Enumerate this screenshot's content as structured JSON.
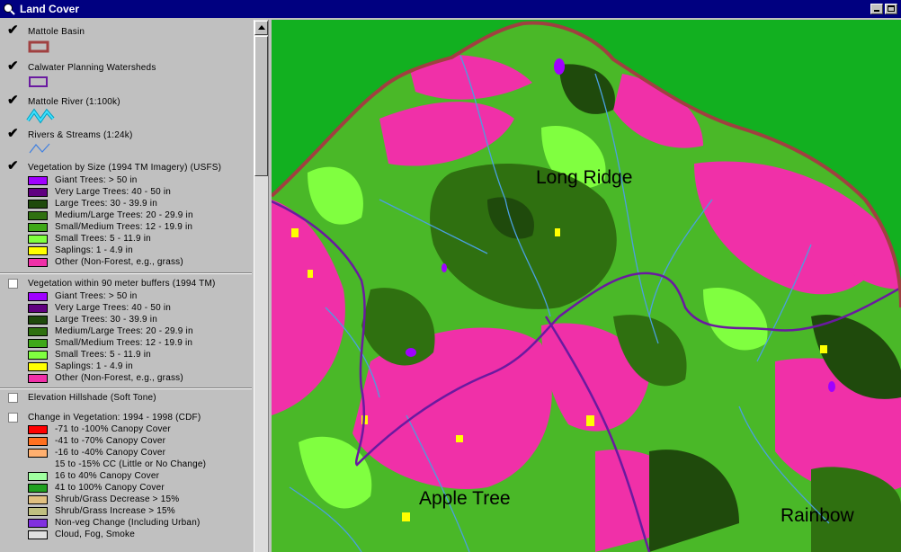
{
  "window": {
    "title": "Land Cover"
  },
  "legend": {
    "layers": [
      {
        "name": "Mattole Basin",
        "checked": true
      },
      {
        "name": "Calwater Planning Watersheds",
        "checked": true
      },
      {
        "name": "Mattole River (1:100k)",
        "checked": true
      },
      {
        "name": "Rivers & Streams (1:24k)",
        "checked": true
      },
      {
        "name": "Vegetation by Size (1994 TM Imagery) (USFS)",
        "checked": true,
        "classes": [
          {
            "label": "Giant Trees: > 50 in",
            "color": "#a000ff"
          },
          {
            "label": "Very Large Trees: 40 - 50 in",
            "color": "#600080"
          },
          {
            "label": "Large Trees: 30 - 39.9 in",
            "color": "#1f4a0c"
          },
          {
            "label": "Medium/Large Trees: 20 - 29.9 in",
            "color": "#2f7010"
          },
          {
            "label": "Small/Medium Trees: 12 - 19.9 in",
            "color": "#3fa818"
          },
          {
            "label": "Small Trees: 5 - 11.9 in",
            "color": "#80ff40"
          },
          {
            "label": "Saplings: 1 - 4.9 in",
            "color": "#ffff00"
          },
          {
            "label": "Other (Non-Forest, e.g., grass)",
            "color": "#f030a8"
          }
        ]
      },
      {
        "name": "Vegetation within 90 meter buffers (1994 TM)",
        "checked": false,
        "classes": [
          {
            "label": "Giant Trees: > 50 in",
            "color": "#a000ff"
          },
          {
            "label": "Very Large Trees: 40 - 50 in",
            "color": "#600080"
          },
          {
            "label": "Large Trees: 30 - 39.9 in",
            "color": "#1f4a0c"
          },
          {
            "label": "Medium/Large Trees: 20 - 29.9 in",
            "color": "#2f7010"
          },
          {
            "label": "Small/Medium Trees: 12 - 19.9 in",
            "color": "#3fa818"
          },
          {
            "label": "Small Trees: 5 - 11.9 in",
            "color": "#80ff40"
          },
          {
            "label": "Saplings: 1 - 4.9 in",
            "color": "#ffff00"
          },
          {
            "label": "Other (Non-Forest, e.g., grass)",
            "color": "#f030a8"
          }
        ]
      },
      {
        "name": "Elevation Hillshade (Soft Tone)",
        "checked": false
      },
      {
        "name": "Change in Vegetation: 1994 - 1998 (CDF)",
        "checked": false,
        "classes": [
          {
            "label": "-71 to -100% Canopy Cover",
            "color": "#ff0000"
          },
          {
            "label": "-41 to -70% Canopy Cover",
            "color": "#ff7020"
          },
          {
            "label": "-16 to -40% Canopy Cover",
            "color": "#ffb070"
          },
          {
            "label": "15 to -15% CC (Little or No Change)",
            "color": "#c0c0c0"
          },
          {
            "label": "16 to 40% Canopy Cover",
            "color": "#a0ffa0"
          },
          {
            "label": "41 to 100% Canopy Cover",
            "color": "#20a020"
          },
          {
            "label": "Shrub/Grass Decrease > 15%",
            "color": "#e0c080"
          },
          {
            "label": "Shrub/Grass Increase > 15%",
            "color": "#c0c080"
          },
          {
            "label": "Non-veg Change (Including Urban)",
            "color": "#8030e0"
          },
          {
            "label": "Cloud, Fog, Smoke",
            "color": "#e0e0e0"
          }
        ]
      }
    ]
  },
  "map": {
    "labels": {
      "long_ridge": "Long Ridge",
      "apple_tree": "Apple Tree",
      "rainbow": "Rainbow"
    },
    "colors": {
      "outside": "#12b020",
      "boundary": "#a04040",
      "river": "#6a1aa0",
      "stream": "#4aa0e0"
    }
  }
}
